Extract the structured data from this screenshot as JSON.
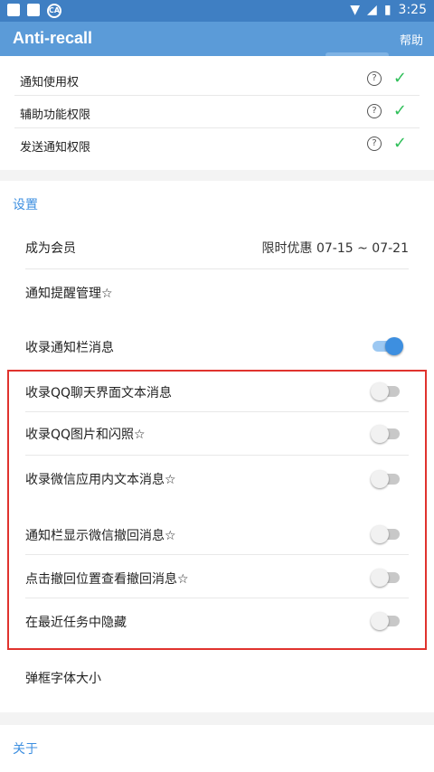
{
  "status_bar": {
    "time": "3:25",
    "app_badge": "CA"
  },
  "app_bar": {
    "title": "Anti-recall",
    "help_label": "帮助"
  },
  "permissions": [
    {
      "label": "通知使用权",
      "granted": true
    },
    {
      "label": "辅助功能权限",
      "granted": true
    },
    {
      "label": "发送通知权限",
      "granted": true
    }
  ],
  "settings": {
    "section_title": "设置",
    "membership": {
      "label": "成为会员",
      "value": "限时优惠 07-15 ~ 07-21"
    },
    "notification_manage": {
      "label": "通知提醒管理☆"
    },
    "record_notification": {
      "label": "收录通知栏消息",
      "on": true
    },
    "record_qq_text": {
      "label": "收录QQ聊天界面文本消息",
      "on": false
    },
    "record_qq_images": {
      "label": "收录QQ图片和闪照☆",
      "on": false
    },
    "record_wechat_text": {
      "label": "收录微信应用内文本消息☆",
      "on": false
    },
    "show_wechat_recall": {
      "label": "通知栏显示微信撤回消息☆",
      "on": false
    },
    "tap_recall_view": {
      "label": "点击撤回位置查看撤回消息☆",
      "on": false
    },
    "hide_recent": {
      "label": "在最近任务中隐藏",
      "on": false
    },
    "font_size": {
      "label": "弹框字体大小"
    }
  },
  "about": {
    "section_title": "关于"
  },
  "colors": {
    "accent": "#3d8fe0",
    "appbar": "#5b9bd8",
    "highlight": "#e0332e",
    "check": "#2fbf59"
  }
}
